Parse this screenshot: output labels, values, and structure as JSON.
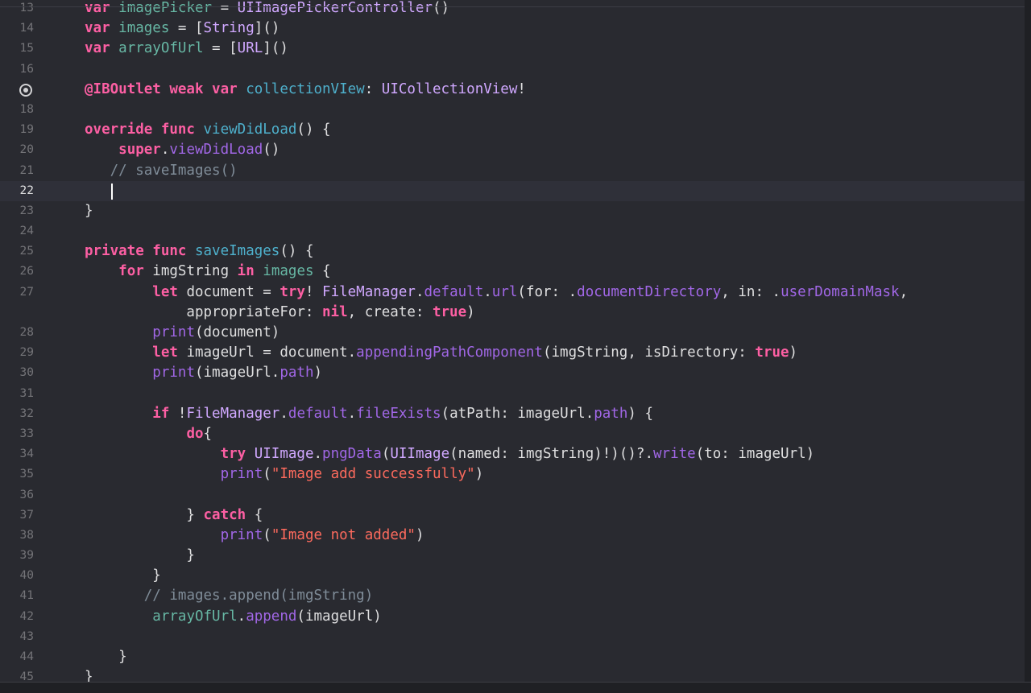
{
  "editor": {
    "current_line": "22",
    "lines": [
      {
        "n": "13",
        "tokens": [
          [
            "kw",
            "var"
          ],
          [
            "plain",
            " "
          ],
          [
            "id",
            "imagePicker"
          ],
          [
            "plain",
            " = "
          ],
          [
            "type",
            "UIImagePickerController"
          ],
          [
            "plain",
            "()"
          ]
        ]
      },
      {
        "n": "14",
        "tokens": [
          [
            "kw",
            "var"
          ],
          [
            "plain",
            " "
          ],
          [
            "id",
            "images"
          ],
          [
            "plain",
            " = ["
          ],
          [
            "type",
            "String"
          ],
          [
            "plain",
            "]()"
          ]
        ]
      },
      {
        "n": "15",
        "tokens": [
          [
            "kw",
            "var"
          ],
          [
            "plain",
            " "
          ],
          [
            "id",
            "arrayOfUrl"
          ],
          [
            "plain",
            " = ["
          ],
          [
            "type",
            "URL"
          ],
          [
            "plain",
            "]()"
          ]
        ]
      },
      {
        "n": "16",
        "tokens": []
      },
      {
        "n": "",
        "breakpoint": true,
        "tokens": [
          [
            "kw",
            "@IBOutlet weak var"
          ],
          [
            "plain",
            " "
          ],
          [
            "func",
            "collectionVIew"
          ],
          [
            "plain",
            ": "
          ],
          [
            "type",
            "UICollectionView"
          ],
          [
            "plain",
            "!"
          ]
        ]
      },
      {
        "n": "18",
        "tokens": []
      },
      {
        "n": "19",
        "tokens": [
          [
            "kw",
            "override func"
          ],
          [
            "plain",
            " "
          ],
          [
            "func",
            "viewDidLoad"
          ],
          [
            "plain",
            "() {"
          ]
        ]
      },
      {
        "n": "20",
        "tokens": [
          [
            "plain",
            "    "
          ],
          [
            "kw",
            "super"
          ],
          [
            "plain",
            "."
          ],
          [
            "prop",
            "viewDidLoad"
          ],
          [
            "plain",
            "()"
          ]
        ]
      },
      {
        "n": "21",
        "tokens": [
          [
            "plain",
            "   "
          ],
          [
            "com",
            "// saveImages()"
          ]
        ]
      },
      {
        "n": "22",
        "tokens": [],
        "caret": true
      },
      {
        "n": "23",
        "tokens": [
          [
            "plain",
            "}"
          ]
        ]
      },
      {
        "n": "24",
        "tokens": []
      },
      {
        "n": "25",
        "tokens": [
          [
            "kw",
            "private func"
          ],
          [
            "plain",
            " "
          ],
          [
            "func",
            "saveImages"
          ],
          [
            "plain",
            "() {"
          ]
        ]
      },
      {
        "n": "26",
        "tokens": [
          [
            "plain",
            "    "
          ],
          [
            "kw",
            "for"
          ],
          [
            "plain",
            " imgString "
          ],
          [
            "kw",
            "in"
          ],
          [
            "plain",
            " "
          ],
          [
            "id",
            "images"
          ],
          [
            "plain",
            " {"
          ]
        ]
      },
      {
        "n": "27",
        "tokens": [
          [
            "plain",
            "        "
          ],
          [
            "kw",
            "let"
          ],
          [
            "plain",
            " document = "
          ],
          [
            "kw",
            "try"
          ],
          [
            "plain",
            "! "
          ],
          [
            "type",
            "FileManager"
          ],
          [
            "plain",
            "."
          ],
          [
            "prop",
            "default"
          ],
          [
            "plain",
            "."
          ],
          [
            "prop",
            "url"
          ],
          [
            "plain",
            "(for: ."
          ],
          [
            "prop",
            "documentDirectory"
          ],
          [
            "plain",
            ", in: ."
          ],
          [
            "prop",
            "userDomainMask"
          ],
          [
            "plain",
            ","
          ]
        ]
      },
      {
        "n": "",
        "tokens": [
          [
            "plain",
            "            appropriateFor: "
          ],
          [
            "kw",
            "nil"
          ],
          [
            "plain",
            ", create: "
          ],
          [
            "kw",
            "true"
          ],
          [
            "plain",
            ")"
          ]
        ]
      },
      {
        "n": "28",
        "tokens": [
          [
            "plain",
            "        "
          ],
          [
            "prop",
            "print"
          ],
          [
            "plain",
            "(document)"
          ]
        ]
      },
      {
        "n": "29",
        "tokens": [
          [
            "plain",
            "        "
          ],
          [
            "kw",
            "let"
          ],
          [
            "plain",
            " imageUrl = document."
          ],
          [
            "prop",
            "appendingPathComponent"
          ],
          [
            "plain",
            "(imgString, isDirectory: "
          ],
          [
            "kw",
            "true"
          ],
          [
            "plain",
            ")"
          ]
        ]
      },
      {
        "n": "30",
        "tokens": [
          [
            "plain",
            "        "
          ],
          [
            "prop",
            "print"
          ],
          [
            "plain",
            "(imageUrl."
          ],
          [
            "prop",
            "path"
          ],
          [
            "plain",
            ")"
          ]
        ]
      },
      {
        "n": "31",
        "tokens": []
      },
      {
        "n": "32",
        "tokens": [
          [
            "plain",
            "        "
          ],
          [
            "kw",
            "if"
          ],
          [
            "plain",
            " !"
          ],
          [
            "type",
            "FileManager"
          ],
          [
            "plain",
            "."
          ],
          [
            "prop",
            "default"
          ],
          [
            "plain",
            "."
          ],
          [
            "prop",
            "fileExists"
          ],
          [
            "plain",
            "(atPath: imageUrl."
          ],
          [
            "prop",
            "path"
          ],
          [
            "plain",
            ") {"
          ]
        ]
      },
      {
        "n": "33",
        "tokens": [
          [
            "plain",
            "            "
          ],
          [
            "kw",
            "do"
          ],
          [
            "plain",
            "{"
          ]
        ]
      },
      {
        "n": "34",
        "tokens": [
          [
            "plain",
            "                "
          ],
          [
            "kw",
            "try"
          ],
          [
            "plain",
            " "
          ],
          [
            "type",
            "UIImage"
          ],
          [
            "plain",
            "."
          ],
          [
            "prop",
            "pngData"
          ],
          [
            "plain",
            "("
          ],
          [
            "type",
            "UIImage"
          ],
          [
            "plain",
            "(named: imgString)!)()?."
          ],
          [
            "prop",
            "write"
          ],
          [
            "plain",
            "(to: imageUrl)"
          ]
        ]
      },
      {
        "n": "35",
        "tokens": [
          [
            "plain",
            "                "
          ],
          [
            "prop",
            "print"
          ],
          [
            "plain",
            "("
          ],
          [
            "str",
            "\"Image add successfully\""
          ],
          [
            "plain",
            ")"
          ]
        ]
      },
      {
        "n": "36",
        "tokens": []
      },
      {
        "n": "37",
        "tokens": [
          [
            "plain",
            "            } "
          ],
          [
            "kw",
            "catch"
          ],
          [
            "plain",
            " {"
          ]
        ]
      },
      {
        "n": "38",
        "tokens": [
          [
            "plain",
            "                "
          ],
          [
            "prop",
            "print"
          ],
          [
            "plain",
            "("
          ],
          [
            "str",
            "\"Image not added\""
          ],
          [
            "plain",
            ")"
          ]
        ]
      },
      {
        "n": "39",
        "tokens": [
          [
            "plain",
            "            }"
          ]
        ]
      },
      {
        "n": "40",
        "tokens": [
          [
            "plain",
            "        }"
          ]
        ]
      },
      {
        "n": "41",
        "tokens": [
          [
            "plain",
            "       "
          ],
          [
            "com",
            "// images.append(imgString)"
          ]
        ]
      },
      {
        "n": "42",
        "tokens": [
          [
            "plain",
            "        "
          ],
          [
            "id",
            "arrayOfUrl"
          ],
          [
            "plain",
            "."
          ],
          [
            "prop",
            "append"
          ],
          [
            "plain",
            "(imageUrl)"
          ]
        ]
      },
      {
        "n": "43",
        "tokens": []
      },
      {
        "n": "44",
        "tokens": [
          [
            "plain",
            "    }"
          ]
        ]
      },
      {
        "n": "45",
        "tokens": [
          [
            "plain",
            "}"
          ]
        ]
      }
    ]
  }
}
